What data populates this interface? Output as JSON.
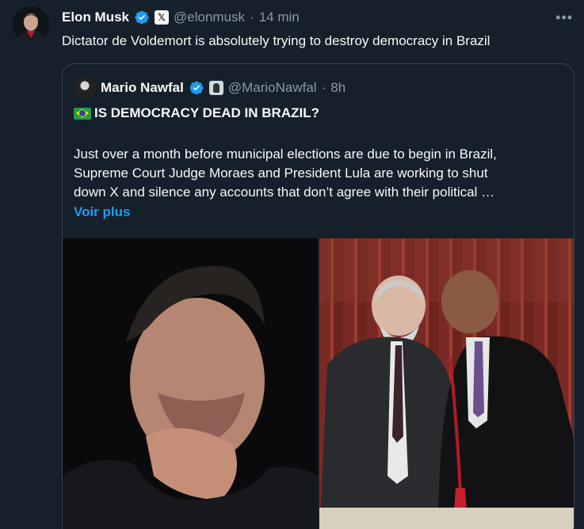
{
  "tweet": {
    "author_name": "Elon Musk",
    "handle": "@elonmusk",
    "separator": "·",
    "time": "14 min",
    "x_badge": "𝕏",
    "text": "Dictator de Voldemort is absolutely trying to destroy democracy in Brazil",
    "more_icon": "•••"
  },
  "quote": {
    "author_name": "Mario Nawfal",
    "handle": "@MarioNawfal",
    "separator": "·",
    "time": "8h",
    "title": "IS DEMOCRACY DEAD IN BRAZIL?",
    "lines": [
      "Just over a month before municipal elections are due to begin in Brazil,",
      "Supreme Court Judge Moraes and President Lula are working to shut",
      "down X and silence any accounts that don’t agree with their political …"
    ],
    "see_more": "Voir plus"
  },
  "colors": {
    "background": "#15202b",
    "accent": "#1d9bf0",
    "muted": "#8b98a5",
    "border": "#38444d"
  },
  "icons": {
    "verified": "verified-badge-icon",
    "more": "more-options-icon",
    "flag": "brazil-flag-icon"
  }
}
